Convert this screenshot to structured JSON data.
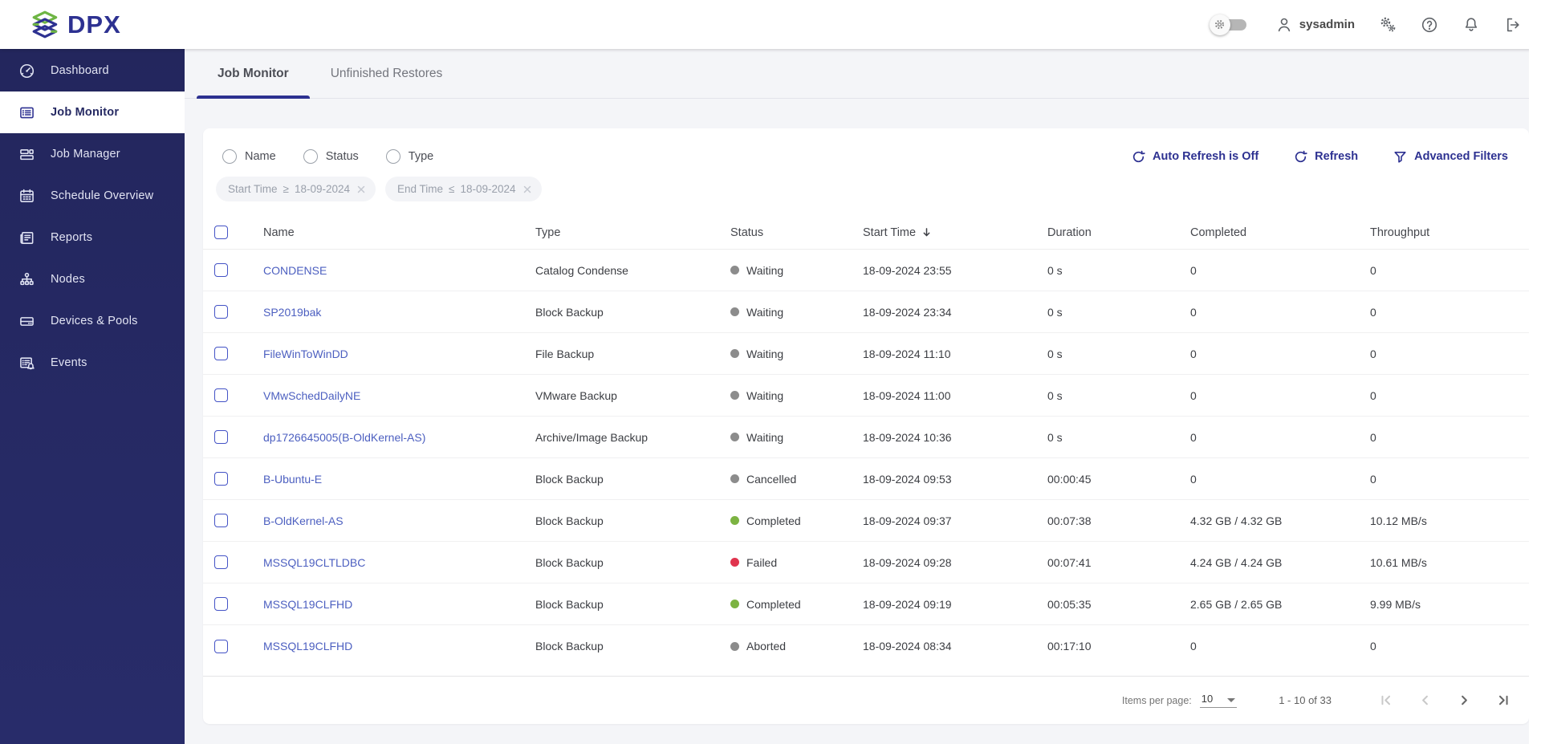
{
  "colors": {
    "accent": "#2D3191",
    "sidebar_bg": "#262A63",
    "link": "#4C5FC0",
    "status_green": "#7CB342",
    "status_red": "#E0344E",
    "status_gray": "#8C8C8C"
  },
  "topbar": {
    "logo_text": "DPX",
    "username": "sysadmin"
  },
  "sidebar": {
    "items": [
      {
        "label": "Dashboard",
        "icon": "dashboard-icon",
        "active": false
      },
      {
        "label": "Job Monitor",
        "icon": "job-monitor-icon",
        "active": true
      },
      {
        "label": "Job Manager",
        "icon": "job-manager-icon",
        "active": false
      },
      {
        "label": "Schedule Overview",
        "icon": "schedule-overview-icon",
        "active": false
      },
      {
        "label": "Reports",
        "icon": "reports-icon",
        "active": false
      },
      {
        "label": "Nodes",
        "icon": "nodes-icon",
        "active": false
      },
      {
        "label": "Devices & Pools",
        "icon": "devices-pools-icon",
        "active": false
      },
      {
        "label": "Events",
        "icon": "events-icon",
        "active": false
      }
    ]
  },
  "tabs": [
    {
      "label": "Job Monitor",
      "active": true
    },
    {
      "label": "Unfinished Restores",
      "active": false
    }
  ],
  "filters": {
    "radios": [
      {
        "label": "Name"
      },
      {
        "label": "Status"
      },
      {
        "label": "Type"
      }
    ],
    "actions": [
      {
        "label": "Auto Refresh is Off",
        "icon": "refresh-icon"
      },
      {
        "label": "Refresh",
        "icon": "refresh-icon"
      },
      {
        "label": "Advanced Filters",
        "icon": "filter-icon"
      }
    ],
    "chips": [
      {
        "field": "Start Time",
        "operator": "≥",
        "value": "18-09-2024"
      },
      {
        "field": "End Time",
        "operator": "≤",
        "value": "18-09-2024"
      }
    ]
  },
  "table": {
    "columns": [
      "Name",
      "Type",
      "Status",
      "Start Time",
      "Duration",
      "Completed",
      "Throughput"
    ],
    "sorted_column": "Start Time",
    "sort_direction": "desc",
    "rows": [
      {
        "name": "CONDENSE",
        "type": "Catalog Condense",
        "status": "Waiting",
        "status_color": "gray",
        "start_time": "18-09-2024 23:55",
        "duration": "0 s",
        "completed": "0",
        "throughput": "0"
      },
      {
        "name": "SP2019bak",
        "type": "Block Backup",
        "status": "Waiting",
        "status_color": "gray",
        "start_time": "18-09-2024 23:34",
        "duration": "0 s",
        "completed": "0",
        "throughput": "0"
      },
      {
        "name": "FileWinToWinDD",
        "type": "File Backup",
        "status": "Waiting",
        "status_color": "gray",
        "start_time": "18-09-2024 11:10",
        "duration": "0 s",
        "completed": "0",
        "throughput": "0"
      },
      {
        "name": "VMwSchedDailyNE",
        "type": "VMware Backup",
        "status": "Waiting",
        "status_color": "gray",
        "start_time": "18-09-2024 11:00",
        "duration": "0 s",
        "completed": "0",
        "throughput": "0"
      },
      {
        "name": "dp1726645005(B-OldKernel-AS)",
        "type": "Archive/Image Backup",
        "status": "Waiting",
        "status_color": "gray",
        "start_time": "18-09-2024 10:36",
        "duration": "0 s",
        "completed": "0",
        "throughput": "0"
      },
      {
        "name": "B-Ubuntu-E",
        "type": "Block Backup",
        "status": "Cancelled",
        "status_color": "gray",
        "start_time": "18-09-2024 09:53",
        "duration": "00:00:45",
        "completed": "0",
        "throughput": "0"
      },
      {
        "name": "B-OldKernel-AS",
        "type": "Block Backup",
        "status": "Completed",
        "status_color": "green",
        "start_time": "18-09-2024 09:37",
        "duration": "00:07:38",
        "completed": "4.32 GB / 4.32 GB",
        "throughput": "10.12 MB/s"
      },
      {
        "name": "MSSQL19CLTLDBC",
        "type": "Block Backup",
        "status": "Failed",
        "status_color": "red",
        "start_time": "18-09-2024 09:28",
        "duration": "00:07:41",
        "completed": "4.24 GB / 4.24 GB",
        "throughput": "10.61 MB/s"
      },
      {
        "name": "MSSQL19CLFHD",
        "type": "Block Backup",
        "status": "Completed",
        "status_color": "green",
        "start_time": "18-09-2024 09:19",
        "duration": "00:05:35",
        "completed": "2.65 GB / 2.65 GB",
        "throughput": "9.99 MB/s"
      },
      {
        "name": "MSSQL19CLFHD",
        "type": "Block Backup",
        "status": "Aborted",
        "status_color": "gray",
        "start_time": "18-09-2024 08:34",
        "duration": "00:17:10",
        "completed": "0",
        "throughput": "0"
      }
    ]
  },
  "pagination": {
    "items_per_page_label": "Items per page:",
    "items_per_page": "10",
    "range": "1 - 10 of 33"
  }
}
